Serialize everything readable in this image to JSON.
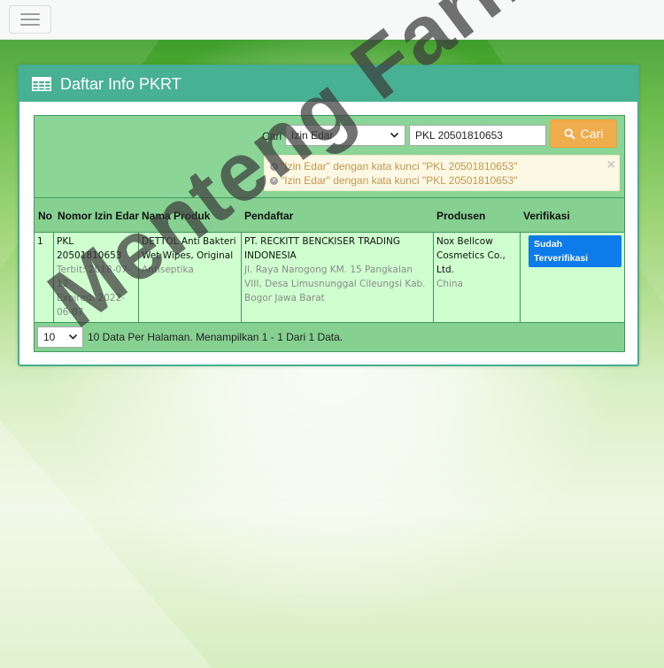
{
  "panel": {
    "title": "Daftar Info PKRT"
  },
  "search": {
    "label": "Cari",
    "field_selected": "Izin Edar",
    "keyword_value": "PKL 20501810653",
    "button_label": "Cari",
    "alerts": [
      "\"Izin Edar\" dengan kata kunci \"PKL 20501810653\"",
      "\"Izin Edar\" dengan kata kunci \"PKL 20501810653\""
    ],
    "alert_close": "×"
  },
  "table": {
    "headers": {
      "no": "No",
      "nomor_izin": "Nomor Izin Edar",
      "nama_produk": "Nama Produk",
      "pendaftar": "Pendaftar",
      "produsen": "Produsen",
      "verifikasi": "Verifikasi"
    },
    "rows": [
      {
        "no": "1",
        "nomor_izin": "PKL 20501810653",
        "terbit": "Terbit: 2018-07-12",
        "expired": "Expired: 2022-06-07",
        "nama_produk": "DETTOL Anti Bakteri Wet Wipes, Original",
        "kategori": "Antiseptika",
        "pendaftar": "PT. RECKITT BENCKISER TRADING INDONESIA",
        "alamat": "Jl. Raya Narogong KM. 15 Pangkalan VIII, Desa Limusnunggal Cileungsi Kab. Bogor Jawa Barat",
        "produsen": "Nox Bellcow Cosmetics Co., Ltd.",
        "negara": "China",
        "verifikasi": "Sudah Terverifikasi"
      }
    ]
  },
  "pagination": {
    "per_page": "10",
    "info": "10 Data Per Halaman. Menampilkan 1 - 1 Dari 1 Data."
  },
  "watermark": "Menteng Farma",
  "colors": {
    "panel_header": "#48b194",
    "table_green": "#86d191",
    "row_bg": "#cfffcf",
    "button_orange": "#f0ad4e",
    "badge_blue": "#0d7bea"
  }
}
